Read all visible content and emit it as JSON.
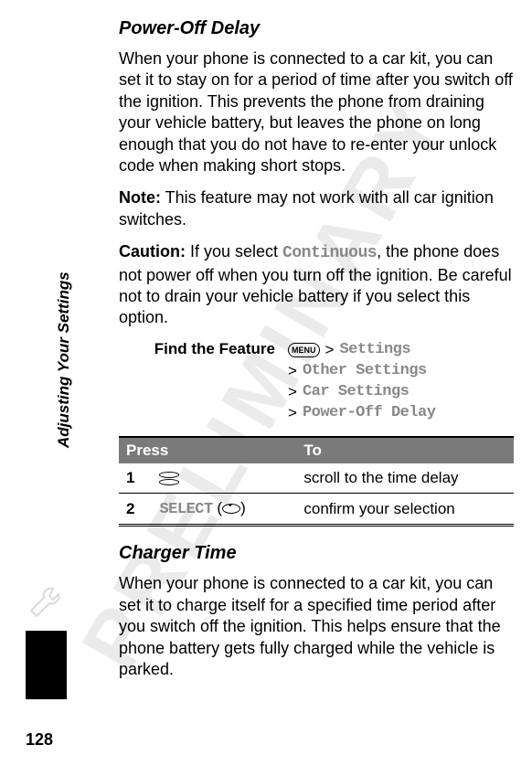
{
  "watermark": "PRELIMINARY",
  "sidebar_label": "Adjusting Your Settings",
  "page_number": "128",
  "section1": {
    "heading": "Power-Off Delay",
    "para1": "When your phone is connected to a car kit, you can set it to stay on for a period of time after you switch off the ignition. This prevents the phone from draining your vehicle battery, but leaves the phone on long enough that you do not have to re-enter your unlock code when making short stops.",
    "note_label": "Note:",
    "note_text": " This feature may not work with all car ignition switches.",
    "caution_label": "Caution:",
    "caution_text_a": " If you select ",
    "caution_inline": "Continuous",
    "caution_text_b": ", the phone does not power off when you turn off the ignition. Be careful not to drain your vehicle battery if you select this option.",
    "find_label": "Find the Feature",
    "menu_label": "MENU",
    "path": [
      "Settings",
      "Other Settings",
      "Car Settings",
      "Power-Off Delay"
    ],
    "table": {
      "head_press": "Press",
      "head_to": "To",
      "rows": [
        {
          "num": "1",
          "press_type": "scroll",
          "to": "scroll to the time delay"
        },
        {
          "num": "2",
          "press_type": "select",
          "press_label": "SELECT",
          "to": "confirm your selection"
        }
      ]
    }
  },
  "section2": {
    "heading": "Charger Time",
    "para1": "When your phone is connected to a car kit, you can set it to charge itself for a specified time period after you switch off the ignition. This helps ensure that the phone battery gets fully charged while the vehicle is parked."
  }
}
